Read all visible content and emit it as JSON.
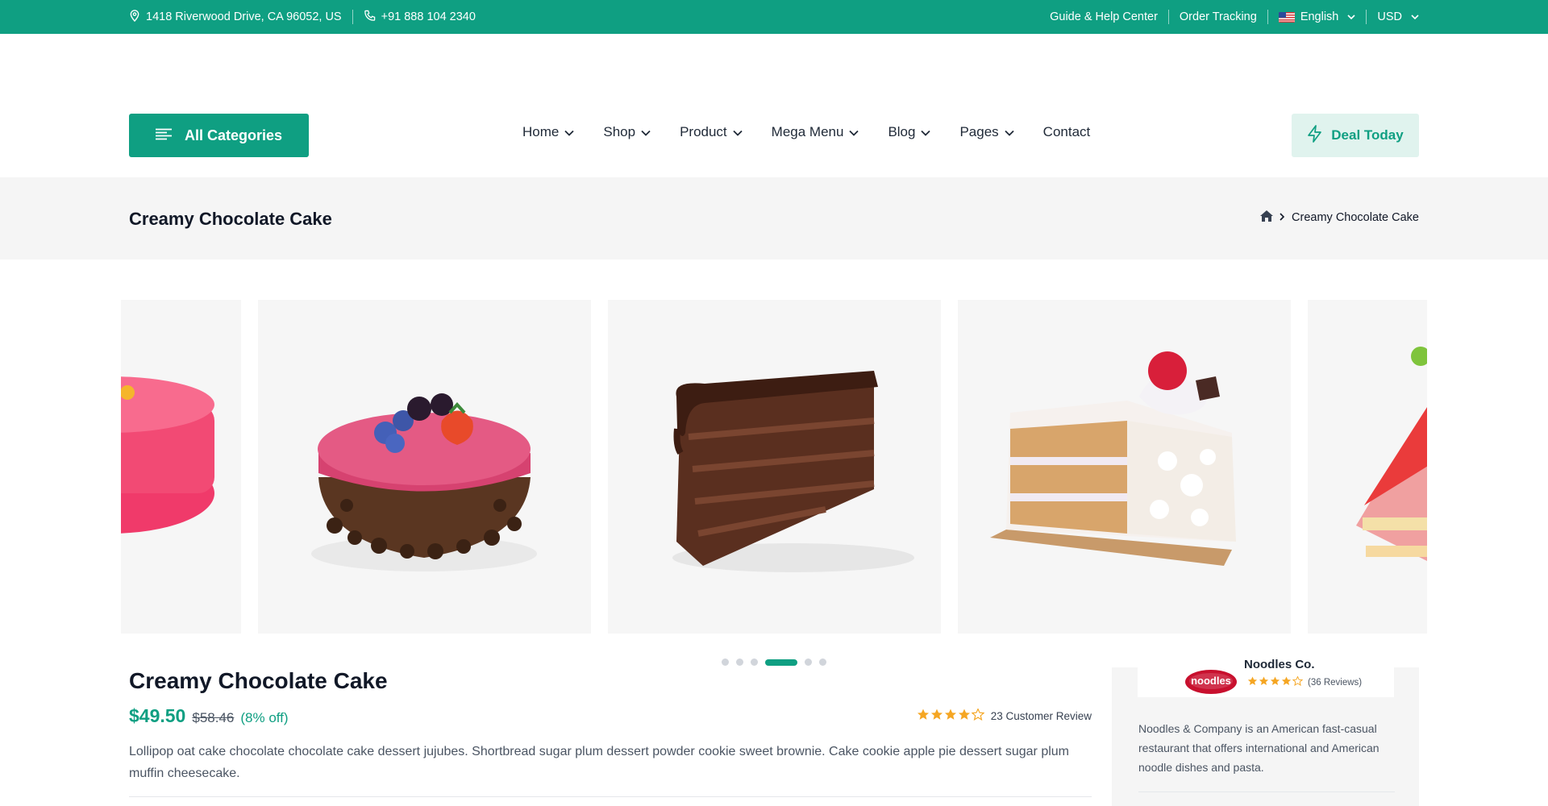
{
  "topbar": {
    "address": "1418 Riverwood Drive, CA 96052, US",
    "phone": "+91 888 104 2340",
    "guide": "Guide & Help Center",
    "tracking": "Order Tracking",
    "language": "English",
    "currency": "USD"
  },
  "header": {
    "all_categories": "All Categories",
    "nav": [
      "Home",
      "Shop",
      "Product",
      "Mega Menu",
      "Blog",
      "Pages",
      "Contact"
    ],
    "deal": "Deal Today"
  },
  "page": {
    "title": "Creamy Chocolate Cake",
    "breadcrumb_current": "Creamy Chocolate Cake"
  },
  "gallery": {
    "slides": [
      "pink-glazed-cake",
      "berry-chocolate-cake",
      "chocolate-cake-slice",
      "cream-cake-slice",
      "strawberry-cake-slice"
    ],
    "active_index": 3,
    "dot_count": 6
  },
  "product": {
    "name": "Creamy Chocolate Cake",
    "price": "$49.50",
    "old_price": "$58.46",
    "discount": "(8% off)",
    "rating": 4,
    "reviews": "23 Customer Review",
    "description": "Lollipop oat cake chocolate chocolate cake dessert jujubes. Shortbread sugar plum dessert powder cookie sweet brownie. Cake cookie apple pie dessert sugar plum muffin cheesecake."
  },
  "vendor": {
    "name": "Noodles Co.",
    "logo_text": "noodles",
    "rating": 4,
    "reviews": "(36 Reviews)",
    "description": "Noodles & Company is an American fast-casual restaurant that offers international and American noodle dishes and pasta."
  },
  "colors": {
    "brand": "#0f9f82",
    "star": "#f5a623"
  }
}
